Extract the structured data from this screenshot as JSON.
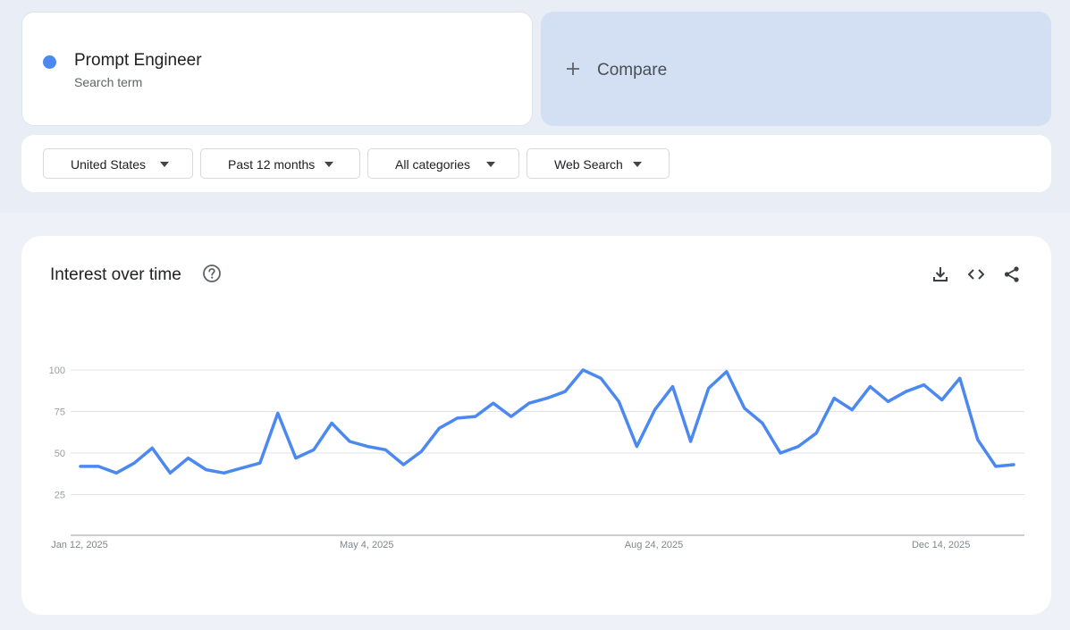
{
  "search_term": {
    "name": "Prompt Engineer",
    "subtitle": "Search term",
    "color": "#4b88f0"
  },
  "compare": {
    "label": "Compare",
    "icon": "plus-icon"
  },
  "filters": [
    {
      "label": "United States",
      "icon": "caret-down-icon"
    },
    {
      "label": "Past 12 months",
      "icon": "caret-down-icon"
    },
    {
      "label": "All categories",
      "icon": "caret-down-icon"
    },
    {
      "label": "Web Search",
      "icon": "caret-down-icon"
    }
  ],
  "chart_panel": {
    "title": "Interest over time",
    "icons": [
      "help-icon",
      "download-icon",
      "embed-code-icon",
      "share-icon"
    ]
  },
  "chart_data": {
    "type": "line",
    "title": "Interest over time",
    "xlabel": "",
    "ylabel": "",
    "ylim": [
      0,
      100
    ],
    "yticks": [
      25,
      50,
      75,
      100
    ],
    "x_tick_labels": [
      "Jan 12, 2025",
      "May 4, 2025",
      "Aug 24, 2025",
      "Dec 14, 2025"
    ],
    "x_tick_indices": [
      0,
      16,
      32,
      48
    ],
    "grid": true,
    "legend": "none",
    "series": [
      {
        "color": "#4b88f0",
        "values": [
          42,
          42,
          38,
          44,
          53,
          38,
          47,
          40,
          38,
          41,
          44,
          74,
          47,
          52,
          68,
          57,
          54,
          52,
          43,
          51,
          65,
          71,
          72,
          80,
          72,
          80,
          83,
          87,
          100,
          95,
          81,
          54,
          76,
          90,
          57,
          89,
          99,
          77,
          68,
          50,
          54,
          62,
          83,
          76,
          90,
          81,
          87,
          91,
          82,
          95,
          58,
          42,
          43
        ]
      }
    ]
  }
}
